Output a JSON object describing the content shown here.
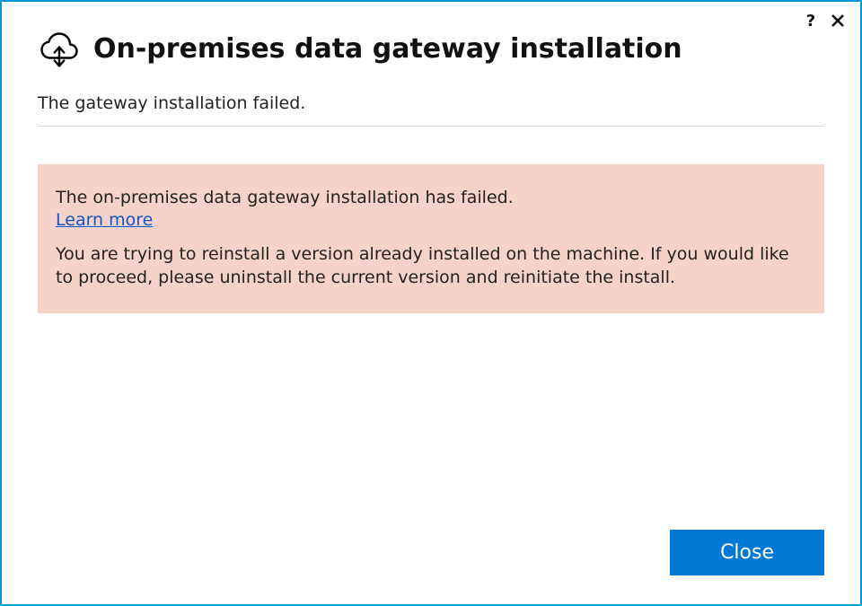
{
  "header": {
    "title": "On-premises data gateway installation"
  },
  "status": {
    "message": "The gateway installation failed."
  },
  "error": {
    "summary": "The on-premises data gateway installation has failed.",
    "learn_more_label": "Learn more",
    "detail": "You are trying to reinstall a version already installed on the machine. If you would like to proceed, please uninstall the current version and reinitiate the install."
  },
  "footer": {
    "close_label": "Close"
  },
  "titlebar": {
    "help_label": "?",
    "close_label": "✕"
  }
}
